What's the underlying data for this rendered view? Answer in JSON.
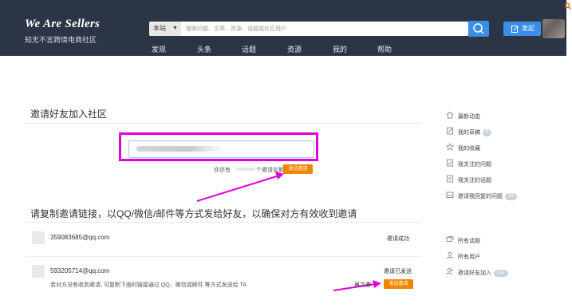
{
  "header": {
    "logo_title": "We Are Sellers",
    "logo_subtitle": "知无不言跨境电商社区",
    "search": {
      "scope": "本站",
      "placeholder": "搜索问题、文章、资源、话题或社区用户"
    },
    "publish_label": "发起",
    "nav": [
      "发现",
      "头条",
      "话题",
      "资源",
      "我的",
      "帮助"
    ]
  },
  "invite": {
    "title": "邀请好友加入社区",
    "remaining_prefix": "你还有",
    "remaining_suffix": "个邀请名额",
    "send_label": "发送邀请"
  },
  "link_section": {
    "title": "请复制邀请链接，以QQ/微信/邮件等方式发给好友，以确保对方有效收到邀请"
  },
  "invites": [
    {
      "email": "359083685@qq.com",
      "status": "邀请成功"
    },
    {
      "email": "593205714@qq.com",
      "status": "邀请已发送",
      "hint": "若对方没有收到邀请, 可复制下面的链接通过 QQ、微信或邮件 等方式发送给 TA",
      "reinvite_label": "再次邀",
      "send_label": "发送邀请"
    }
  ],
  "sidebar": {
    "group1": [
      {
        "label": "最新动态",
        "icon": "home-icon"
      },
      {
        "label": "我的草稿",
        "icon": "draft-icon",
        "badge": "0"
      },
      {
        "label": "我的收藏",
        "icon": "star-icon"
      },
      {
        "label": "我关注的问题",
        "icon": "question-follow-icon"
      },
      {
        "label": "我关注的话题",
        "icon": "topic-follow-icon"
      },
      {
        "label": "邀请我回复的问题",
        "icon": "inbox-icon",
        "badge": "76"
      }
    ],
    "group2": [
      {
        "label": "所有话题",
        "icon": "topics-icon"
      },
      {
        "label": "所有用户",
        "icon": "user-icon"
      },
      {
        "label": "邀请好友加入",
        "icon": "invite-user-icon",
        "badge": "137"
      }
    ]
  },
  "colors": {
    "header_bg": "#2b3545",
    "accent_blue": "#3a8ee6",
    "send_orange": "#f28500",
    "highlight_magenta": "#e100d8"
  }
}
